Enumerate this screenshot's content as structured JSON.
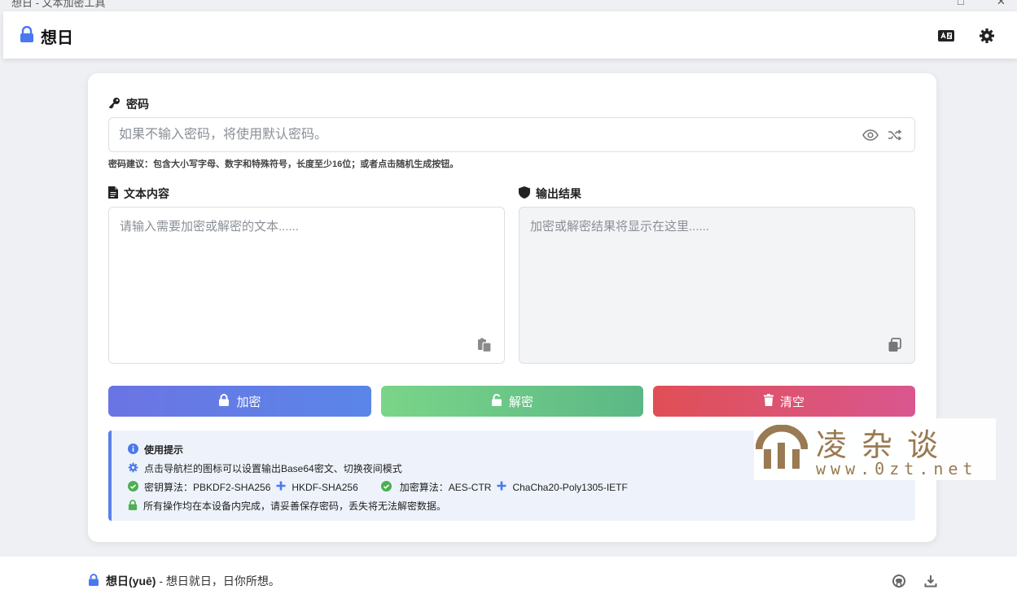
{
  "window": {
    "title": "想日 - 文本加密工具",
    "min_glyph": "□",
    "close_glyph": "✕"
  },
  "header": {
    "app_name": "想日",
    "brand_icon": "lock-icon",
    "actions": [
      {
        "name": "base64-toggle",
        "icon": "language-card-icon"
      },
      {
        "name": "settings",
        "icon": "gear-icon"
      }
    ]
  },
  "password": {
    "label": "密码",
    "placeholder": "如果不输入密码，将使用默认密码。",
    "value": "",
    "hint": "密码建议：包含大小写字母、数字和特殊符号，长度至少16位；或者点击随机生成按钮。"
  },
  "input_text": {
    "label": "文本内容",
    "placeholder": "请输入需要加密或解密的文本......",
    "value": ""
  },
  "output_text": {
    "label": "输出结果",
    "placeholder": "加密或解密结果将显示在这里......",
    "value": ""
  },
  "buttons": {
    "encrypt": "加密",
    "decrypt": "解密",
    "clear": "清空"
  },
  "tips": {
    "title": "使用提示",
    "line1": "点击导航栏的图标可以设置输出Base64密文、切换夜间模式",
    "kdf_label": "密钥算法：",
    "kdf_a": "PBKDF2-SHA256",
    "kdf_b": "HKDF-SHA256",
    "enc_label": "加密算法：",
    "enc_a": "AES-CTR",
    "enc_b": "ChaCha20-Poly1305-IETF",
    "line3": "所有操作均在本设备内完成，请妥善保存密码，丢失将无法解密数据。"
  },
  "watermark": {
    "text": "凌杂谈",
    "url": "www.0zt.net"
  },
  "footer": {
    "name": "想日(yuē)",
    "tagline": " - 想日就日，日你所想。",
    "links": [
      {
        "name": "github",
        "icon": "github-icon"
      },
      {
        "name": "download",
        "icon": "download-icon"
      }
    ]
  },
  "colors": {
    "accent": "#5b7fe8",
    "encrypt_gradient": [
      "#6b74e4",
      "#5a86e8"
    ],
    "decrypt_gradient": [
      "#7ad588",
      "#5bb886"
    ],
    "clear_gradient": [
      "#e04f55",
      "#d9578f"
    ],
    "success": "#4caf50"
  }
}
